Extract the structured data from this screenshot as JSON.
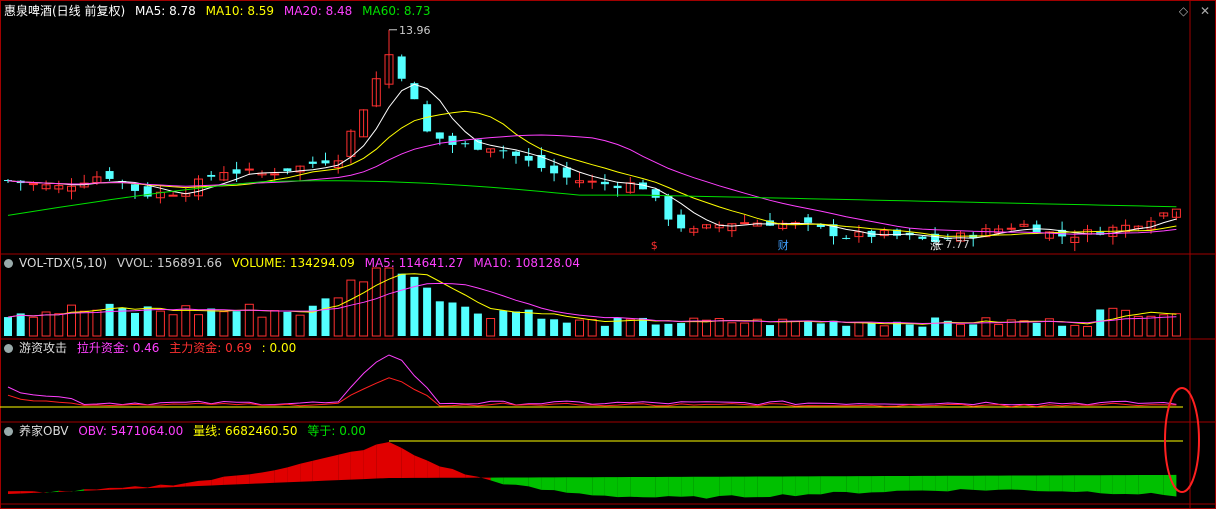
{
  "panel_main": {
    "title": "惠泉啤酒(日线 前复权)",
    "ma": [
      {
        "label": "MA5: 8.78",
        "color": "#ffffff"
      },
      {
        "label": "MA10: 8.59",
        "color": "#ffff00"
      },
      {
        "label": "MA20: 8.48",
        "color": "#ff40ff"
      },
      {
        "label": "MA60: 8.73",
        "color": "#00e000"
      }
    ],
    "high_label": "13.96",
    "low_label": "7.77",
    "markers": [
      {
        "text": "$",
        "color": "#ff3030"
      },
      {
        "text": "财",
        "color": "#40a0ff"
      },
      {
        "text": "涨",
        "color": "#ffffff"
      }
    ]
  },
  "panel_vol": {
    "name": "VOL-TDX(5,10)",
    "items": [
      {
        "label": "VVOL: 156891.66",
        "color": "#cccccc"
      },
      {
        "label": "VOLUME: 134294.09",
        "color": "#ffff00"
      },
      {
        "label": "MA5: 114641.27",
        "color": "#ff40ff"
      },
      {
        "label": "MA10: 108128.04",
        "color": "#ff40ff"
      }
    ]
  },
  "panel_yz": {
    "name": "游资攻击",
    "items": [
      {
        "label": "拉升资金: 0.46",
        "color": "#ff40ff"
      },
      {
        "label": "主力资金: 0.69",
        "color": "#ff3030"
      },
      {
        "label": ": 0.00",
        "color": "#ffff00"
      }
    ]
  },
  "panel_obv": {
    "name": "养家OBV",
    "items": [
      {
        "label": "OBV: 5471064.00",
        "color": "#ff40ff"
      },
      {
        "label": "量线: 6682460.50",
        "color": "#ffff00"
      },
      {
        "label": "等于: 0.00",
        "color": "#00e000"
      }
    ]
  },
  "icons": [
    "diamond-icon",
    "close-icon"
  ],
  "chart_data": {
    "type": "candlestick",
    "title": "惠泉啤酒(日线 前复权)",
    "bars": 93,
    "price_range": [
      7.6,
      14.3
    ],
    "high": 13.96,
    "low": 7.77,
    "last_close": 8.78,
    "series": [
      {
        "name": "MA5",
        "last": 8.78
      },
      {
        "name": "MA10",
        "last": 8.59
      },
      {
        "name": "MA20",
        "last": 8.48
      },
      {
        "name": "MA60",
        "last": 8.73
      }
    ],
    "volume": {
      "VVOL": 156891.66,
      "VOLUME": 134294.09,
      "MA5": 114641.27,
      "MA10": 108128.04
    },
    "yzgj": {
      "拉升资金": 0.46,
      "主力资金": 0.69,
      "other": 0.0
    },
    "obv": {
      "OBV": 5471064.0,
      "量线": 6682460.5,
      "等于": 0.0
    }
  }
}
